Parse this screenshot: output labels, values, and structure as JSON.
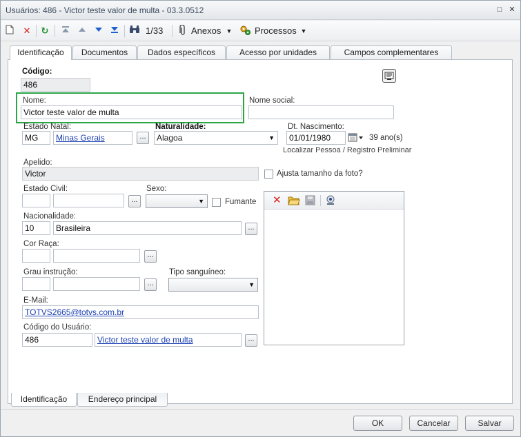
{
  "window": {
    "title": "Usuários: 486 - Victor teste valor de multa - 03.3.0512"
  },
  "toolbar": {
    "record_position": "1/33",
    "anexos_label": "Anexos",
    "processos_label": "Processos"
  },
  "tabs": [
    {
      "label": "Identificação"
    },
    {
      "label": "Documentos"
    },
    {
      "label": "Dados específicos"
    },
    {
      "label": "Acesso por unidades"
    },
    {
      "label": "Campos complementares"
    }
  ],
  "bottom_tabs": [
    {
      "label": "Identificação"
    },
    {
      "label": "Endereço principal"
    }
  ],
  "form": {
    "codigo": {
      "label": "Código:",
      "value": "486"
    },
    "nome": {
      "label": "Nome:",
      "value": "Victor teste valor de multa"
    },
    "nome_social": {
      "label": "Nome social:",
      "value": ""
    },
    "estado_natal": {
      "label": "Estado Natal:",
      "uf": "MG",
      "name": "Minas Gerais"
    },
    "naturalidade": {
      "label": "Naturalidade:",
      "value": "Alagoa"
    },
    "dt_nascimento": {
      "label": "Dt. Nascimento:",
      "value": "01/01/1980",
      "age": "39 ano(s)"
    },
    "localizar_link": "Localizar Pessoa / Registro Preliminar",
    "apelido": {
      "label": "Apelido:",
      "value": "Victor"
    },
    "ajusta_foto": {
      "label": "Ajusta tamanho da foto?"
    },
    "estado_civil": {
      "label": "Estado Civil:"
    },
    "sexo": {
      "label": "Sexo:"
    },
    "fumante": {
      "label": "Fumante"
    },
    "nacionalidade": {
      "label": "Nacionalidade:",
      "code": "10",
      "name": "Brasileira"
    },
    "cor_raca": {
      "label": "Cor Raça:"
    },
    "grau_instrucao": {
      "label": "Grau instrução:"
    },
    "tipo_sanguineo": {
      "label": "Tipo sanguíneo:"
    },
    "email": {
      "label": "E-Mail:",
      "value": "TOTVS2665@totvs.com.br"
    },
    "codigo_usuario": {
      "label": "Código do Usuário:",
      "code": "486",
      "name": "Victor teste valor de multa"
    }
  },
  "buttons": {
    "ok": "OK",
    "cancelar": "Cancelar",
    "salvar": "Salvar"
  },
  "dots_label": "...",
  "colors": {
    "highlight": "#2aa648",
    "link": "#1a3fb4",
    "delete_red": "#d42020"
  }
}
